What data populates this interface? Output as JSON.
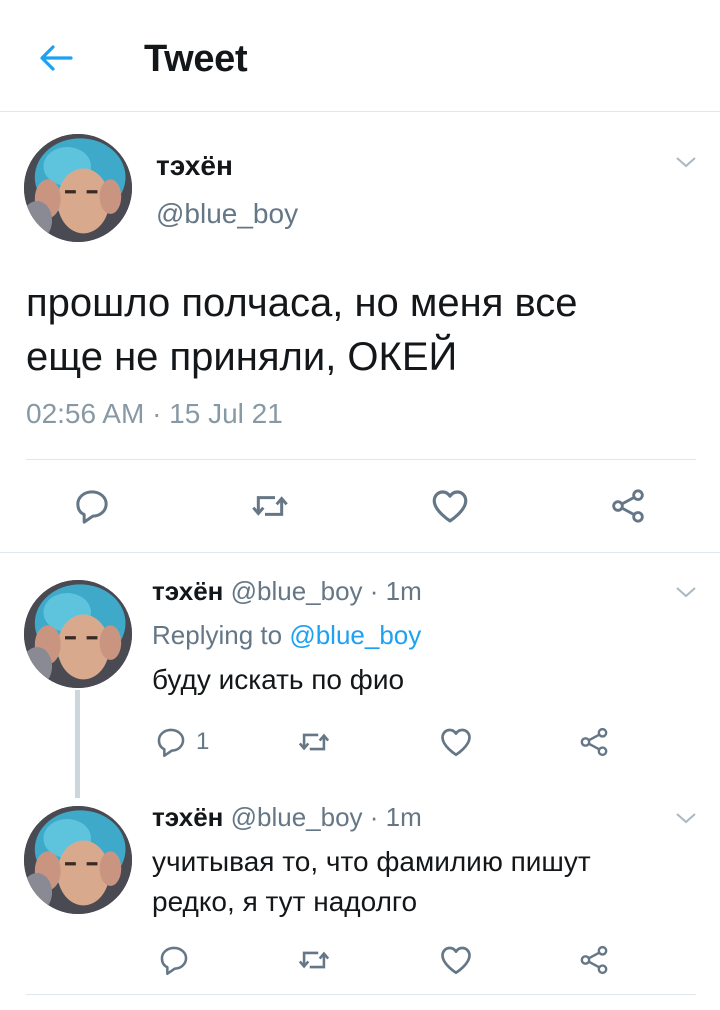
{
  "header": {
    "title": "Tweet",
    "back_icon": "arrow-left-icon",
    "accent": "#1da1f2"
  },
  "tweet": {
    "author_name": "тэхён",
    "author_handle": "@blue_boy",
    "text_line1": "прошло полчаса, но меня все",
    "text_line2": "еще не приняли, ОКЕЙ",
    "timestamp": "02:56 AM · 15 Jul 21",
    "actions": [
      "reply-icon",
      "retweet-icon",
      "like-icon",
      "share-icon"
    ]
  },
  "replies": [
    {
      "author_name": "тэхён",
      "author_handle": "@blue_boy",
      "time": "· 1m",
      "replying_prefix": "Replying to",
      "replying_handle": "@blue_boy",
      "text_line1": "буду искать по фио",
      "reply_count": "1"
    },
    {
      "author_name": "тэхён",
      "author_handle": "@blue_boy",
      "time": "· 1m",
      "text_line1": "учитывая то, что фамилию пишут",
      "text_line2": "редко, я тут надолго"
    }
  ]
}
